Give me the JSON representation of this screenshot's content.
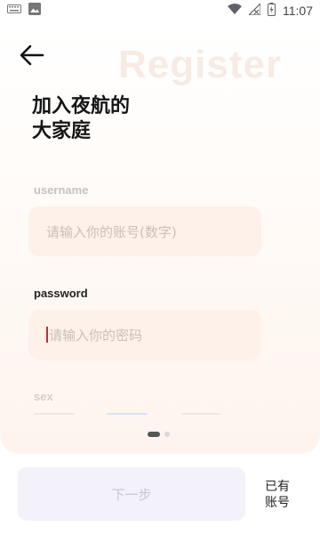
{
  "status_bar": {
    "time": "11:07",
    "icons": [
      "keyboard-icon",
      "image-icon",
      "wifi-icon",
      "no-signal-icon",
      "battery-charging-icon"
    ]
  },
  "header": {
    "background_text": "Register",
    "back_icon": "arrow-left-icon",
    "title_line1": "加入夜航的",
    "title_line2": "大家庭"
  },
  "form": {
    "username_label": "username",
    "username_placeholder": "请输入你的账号(数字)",
    "password_label": "password",
    "password_placeholder": "请输入你的密码",
    "sex_label": "sex"
  },
  "pager": {
    "pages": 2,
    "current": 1
  },
  "footer": {
    "next_label": "下一步",
    "has_account_line1": "已有",
    "has_account_line2": "账号"
  },
  "colors": {
    "accent_caret": "#c0303a",
    "input_bg": "#fdf1e9",
    "button_bg": "#f3f2fb"
  }
}
